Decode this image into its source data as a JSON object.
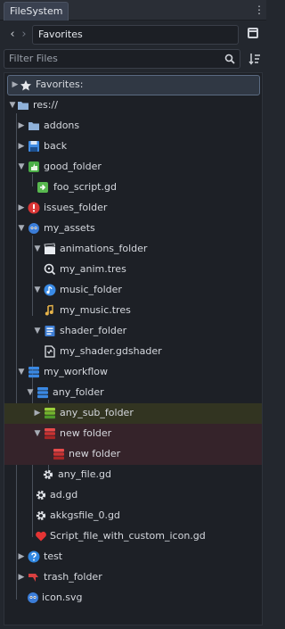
{
  "panel": {
    "tab_label": "FileSystem",
    "menu_icon": "vertical-dots-icon"
  },
  "nav": {
    "path_value": "Favorites"
  },
  "filter": {
    "placeholder": "Filter Files"
  },
  "tree": {
    "favorites": "Favorites:",
    "res": "res://",
    "addons": "addons",
    "back": "back",
    "good_folder": "good_folder",
    "foo_script": "foo_script.gd",
    "issues_folder": "issues_folder",
    "my_assets": "my_assets",
    "animations_folder": "animations_folder",
    "my_anim": "my_anim.tres",
    "music_folder": "music_folder",
    "my_music": "my_music.tres",
    "shader_folder": "shader_folder",
    "my_shader": "my_shader.gdshader",
    "my_workflow": "my_workflow",
    "any_folder": "any_folder",
    "any_sub_folder": "any_sub_folder",
    "new_folder": "new folder",
    "new_folder_child": "new folder",
    "any_file": "any_file.gd",
    "ad": "ad.gd",
    "akkgsfile": "akkgsfile_0.gd",
    "script_custom": "Script_file_with_custom_icon.gd",
    "test": "test",
    "trash_folder": "trash_folder",
    "icon_svg": "icon.svg"
  },
  "colors": {
    "background": "#23272e",
    "tree_bg": "#1d2026",
    "selection_border": "#5b6b82",
    "highlight_yellow": "#323421",
    "highlight_red": "#35232a",
    "folder_blue": "#8fb1d9",
    "icon_blue": "#2f86e0",
    "icon_green": "#58b84f",
    "icon_red": "#d63a3a"
  }
}
